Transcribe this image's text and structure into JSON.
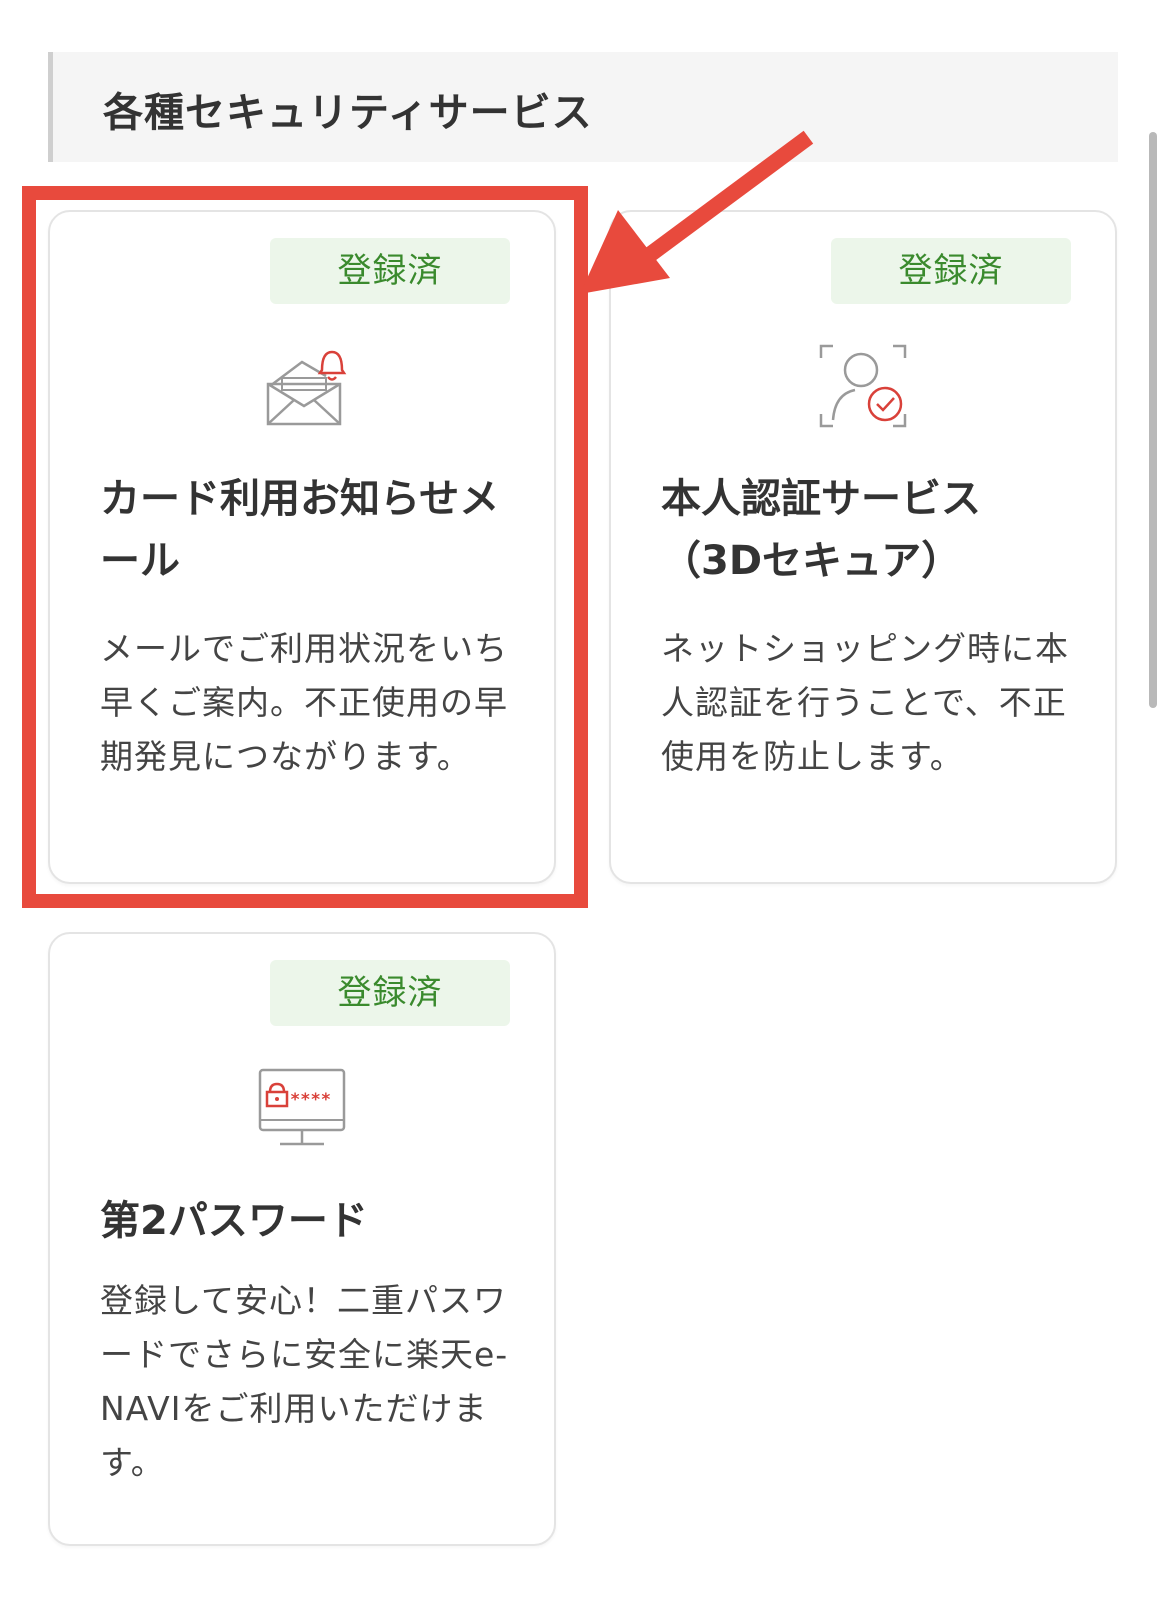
{
  "section": {
    "title": "各種セキュリティサービス"
  },
  "cards": [
    {
      "badge": "登録済",
      "icon": "mail-bell-icon",
      "title": "カード利用お知らせメール",
      "description": "メールでご利用状況をいち早くご案内。不正使用の早期発見につながります。"
    },
    {
      "badge": "登録済",
      "icon": "face-verify-icon",
      "title": "本人認証サービス（3Dセキュア）",
      "description": "ネットショッピング時に本人認証を行うことで、不正使用を防止します。"
    },
    {
      "badge": "登録済",
      "icon": "monitor-password-icon",
      "icon_text": "****",
      "title": "第2パスワード",
      "description": "登録して安心！二重パスワードでさらに安全に楽天e-NAVIをご利用いただけます。"
    }
  ],
  "colors": {
    "badge_bg": "#ecf6ea",
    "badge_text": "#3a8a2d",
    "highlight": "#e84a3d",
    "icon_accent": "#d9413a",
    "icon_gray": "#9a9a9a"
  }
}
